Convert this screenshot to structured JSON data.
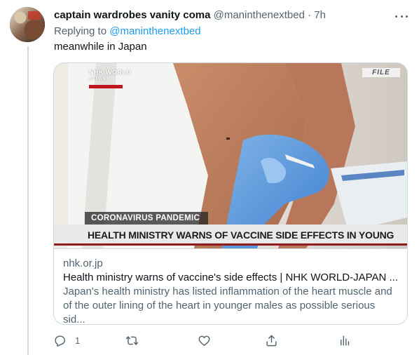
{
  "tweet": {
    "display_name": "captain wardrobes vanity coma",
    "handle": "@maninthenextbed",
    "time_sep": " · ",
    "time": "7h",
    "replying_prefix": "Replying to ",
    "replying_handle": "@maninthenextbed",
    "text": "meanwhile in Japan"
  },
  "card": {
    "image": {
      "logo_main": "NHK WORLD",
      "logo_sub": "JAPAN",
      "file_tag": "FILE",
      "banner_top": "CORONAVIRUS PANDEMIC",
      "banner_main": "HEALTH MINISTRY WARNS OF VACCINE SIDE EFFECTS IN YOUNG MALES"
    },
    "domain": "nhk.or.jp",
    "title": "Health ministry warns of vaccine's side effects | NHK WORLD-JAPAN ...",
    "description": "Japan's health ministry has listed inflammation of the heart muscle and of the outer lining of the heart in younger males as possible serious sid..."
  },
  "actions": {
    "reply_count": "1",
    "retweet_count": "",
    "like_count": ""
  },
  "colors": {
    "link": "#1d9bf0",
    "muted": "#536471",
    "text": "#0f1419",
    "border": "#cfd9de",
    "banner_accent": "#8e1c1c"
  }
}
